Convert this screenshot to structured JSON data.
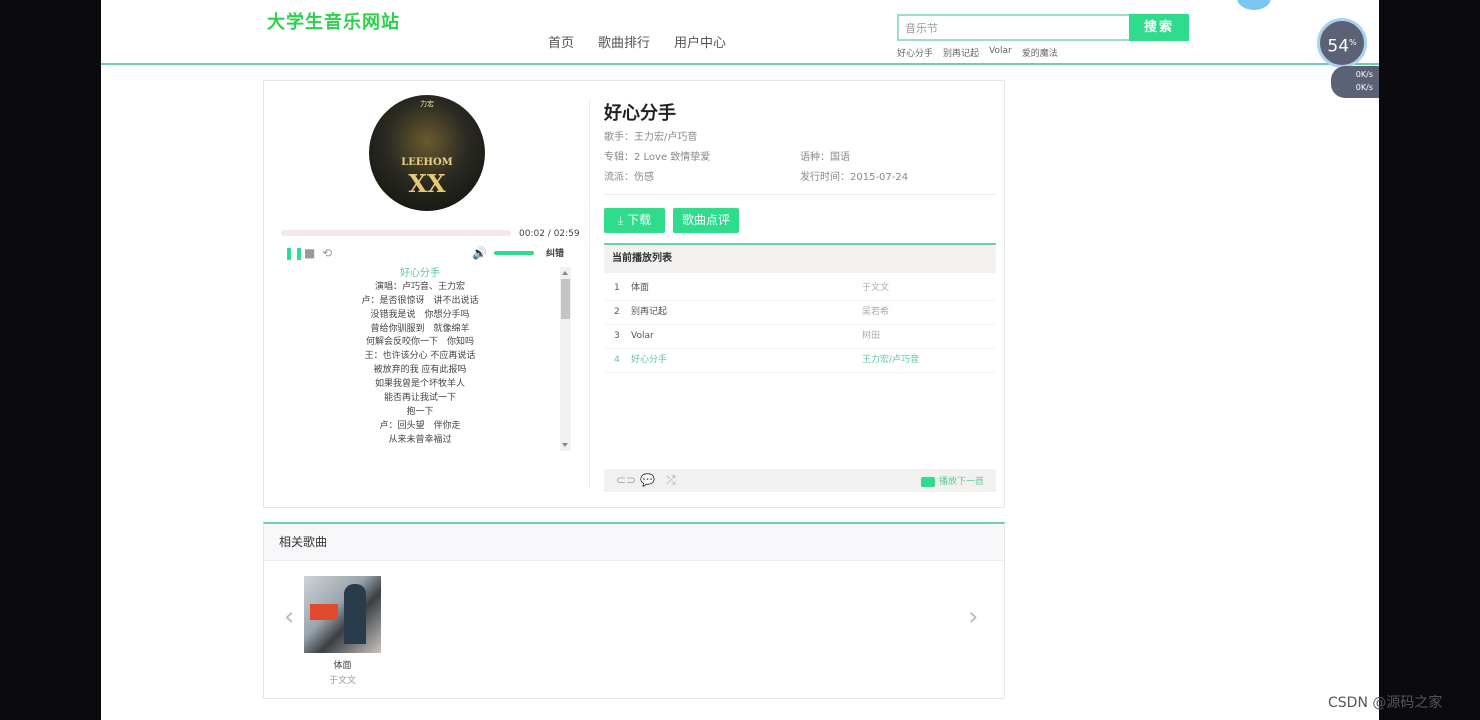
{
  "site": {
    "logo": "大学生音乐网站"
  },
  "nav": {
    "items": [
      "首页",
      "歌曲排行",
      "用户中心"
    ]
  },
  "search": {
    "value": "音乐节",
    "button": "搜索",
    "hot": [
      "好心分手",
      "别再记起",
      "Volar",
      "爱的魔法"
    ]
  },
  "speed_widget": {
    "percent": "54",
    "percent_sign": "%",
    "up": "0K/s",
    "down": "0K/s"
  },
  "player": {
    "cover_text_top": "力宏",
    "cover_text_mid": "LEEHOM",
    "cover_text_big": "XX",
    "time": "00:02 / 02:59",
    "progress": 0.01,
    "volume": 1.0,
    "error_btn": "纠错",
    "lyrics": [
      "好心分手",
      "演唱：卢巧音、王力宏",
      "卢：是否很惊讶　讲不出说话",
      "没错我是说　你想分手吗",
      "曾给你驯服到　就像绵羊",
      "何解会反咬你一下　你知吗",
      "王：也许该分心 不应再说话",
      "被放弃的我 应有此报吗",
      "如果我曾是个坏牧羊人",
      "能否再让我试一下",
      "抱一下",
      "卢：回头望　伴你走",
      "从来未曾幸福过"
    ]
  },
  "song": {
    "title": "好心分手",
    "singer_label": "歌手：",
    "singer": "王力宏/卢巧音",
    "album_label": "专辑：",
    "album": "2 Love 致情挚爱",
    "lang_label": "语种：",
    "lang": "国语",
    "genre_label": "流派：",
    "genre": "伤感",
    "date_label": "发行时间：",
    "date": "2015-07-24",
    "download": "下载",
    "comment": "歌曲点评"
  },
  "playlist": {
    "title": "当前播放列表",
    "rows": [
      {
        "no": "1",
        "song": "体面",
        "artist": "于文文"
      },
      {
        "no": "2",
        "song": "别再记起",
        "artist": "吴若希"
      },
      {
        "no": "3",
        "song": "Volar",
        "artist": "树田"
      },
      {
        "no": "4",
        "song": "好心分手",
        "artist": "王力宏/卢巧音"
      }
    ],
    "next": "播放下一首"
  },
  "related": {
    "title": "相关歌曲",
    "items": [
      {
        "song": "体面",
        "artist": "于文文"
      }
    ]
  },
  "watermark": "CSDN @源码之家"
}
